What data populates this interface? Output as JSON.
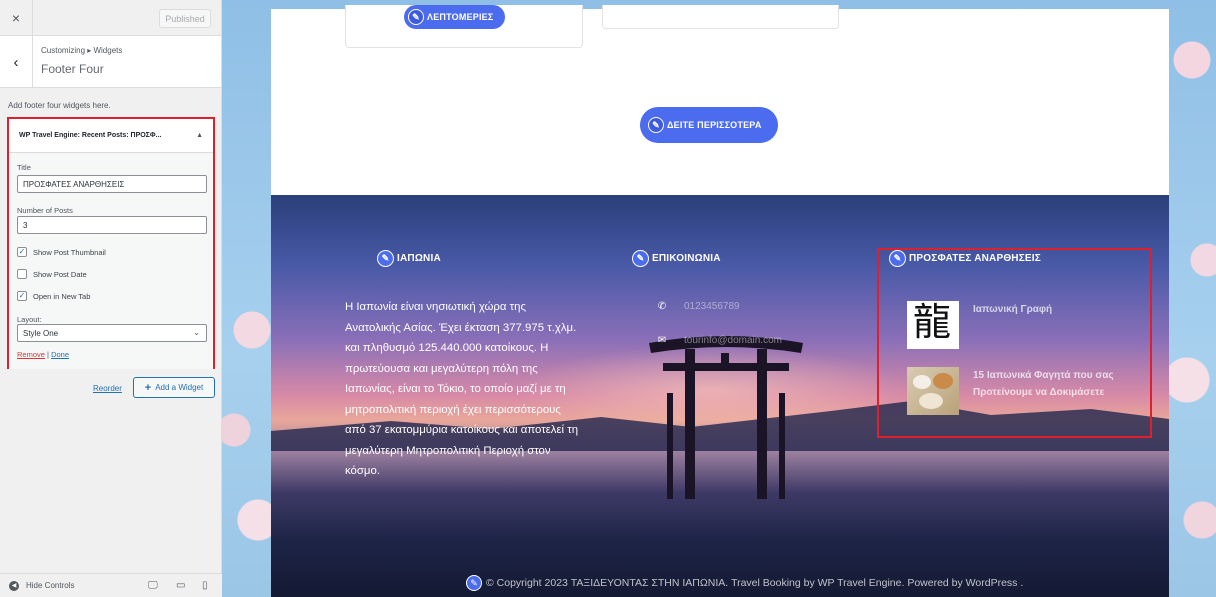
{
  "customizer": {
    "close_glyph": "×",
    "publish_label": "Published",
    "back_glyph": "‹",
    "breadcrumb": "Customizing ▸ Widgets",
    "section_title": "Footer Four",
    "description": "Add footer four widgets here.",
    "widget": {
      "header": "WP Travel Engine: Recent Posts: ΠΡΟΣΦ...",
      "title_label": "Title",
      "title_value": "ΠΡΟΣΦΑΤΕΣ ΑΝΑΡΘΗΣΕΙΣ",
      "num_posts_label": "Number of Posts",
      "num_posts_value": "3",
      "show_thumbnail_label": "Show Post Thumbnail",
      "show_thumbnail_checked": true,
      "show_date_label": "Show Post Date",
      "show_date_checked": false,
      "new_tab_label": "Open in New Tab",
      "new_tab_checked": true,
      "layout_label": "Layout:",
      "layout_value": "Style One",
      "remove_label": "Remove",
      "separator": "|",
      "done_label": "Done"
    },
    "reorder_label": "Reorder",
    "add_widget_label": "Add a Widget",
    "hide_controls_label": "Hide Controls"
  },
  "preview": {
    "details_button": "ΛΕΠΤΟΜΕΡΙΕΣ",
    "see_more_button": "ΔΕΙΤΕ ΠΕΡΙΣΣΟΤΕΡΑ",
    "footer": {
      "col1_title": "ΙΑΠΩΝΙΑ",
      "col1_text": "Η Ιαπωνία είναι νησιωτική χώρα της Ανατολικής Ασίας. Έχει έκταση 377.975 τ.χλμ. και πληθυσμό 125.440.000 κατοίκους. Η πρωτεύουσα και μεγαλύτερη πόλη της Ιαπωνίας, είναι το Τόκιο, το οποίο μαζί με τη μητροπολιτική περιοχή έχει περισσότερους από 37 εκατομμύρια κατοίκους και αποτελεί τη μεγαλύτερη Μητροπολιτική Περιοχή στον κόσμο.",
      "col2_title": "ΕΠΙΚΟΙΝΩΝΙΑ",
      "phone": "0123456789",
      "email": "tourinfo@domain.com",
      "col3_title": "ΠΡΟΣΦΑΤΕΣ ΑΝΑΡΘΗΣΕΙΣ",
      "posts": [
        {
          "title": "Ιαπωνική Γραφή",
          "thumb_text": "龍"
        },
        {
          "title": "15 Ιαπωνικά Φαγητά που σας Προτείνουμε να Δοκιμάσετε"
        }
      ],
      "copyright": "© Copyright 2023 ΤΑΞΙΔΕΥΟΝΤΑΣ ΣΤΗΝ ΙΑΠΩΝΙΑ. Travel Booking by WP Travel Engine. Powered by WordPress ."
    }
  },
  "colors": {
    "accent_blue": "#4c6cf0",
    "highlight_red": "#e01f2d",
    "wp_link": "#2271b1"
  }
}
